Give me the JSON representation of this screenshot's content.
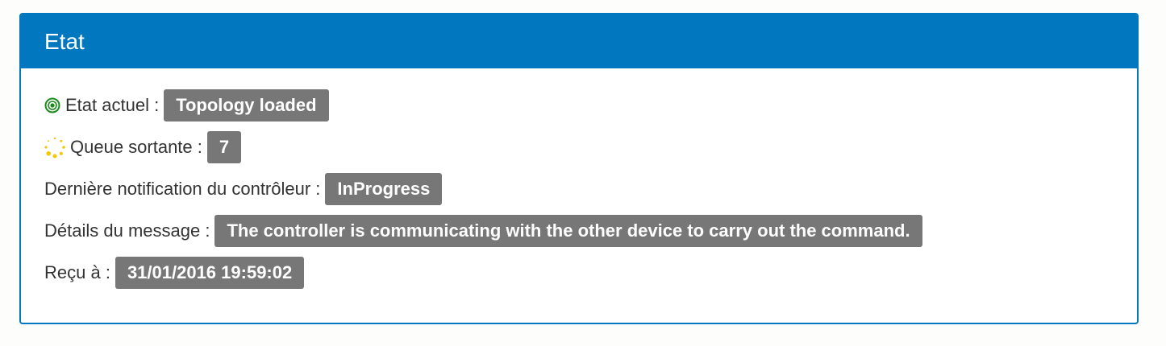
{
  "panel": {
    "title": "Etat"
  },
  "rows": [
    {
      "label": "Etat actuel :",
      "value": "Topology loaded",
      "icon": "status-ok-icon"
    },
    {
      "label": "Queue sortante :",
      "value": "7",
      "icon": "spinner-icon"
    },
    {
      "label": "Dernière notification du contrôleur :",
      "value": "InProgress"
    },
    {
      "label": "Détails du message :",
      "value": "The controller is communicating with the other device to carry out the command."
    },
    {
      "label": "Reçu à :",
      "value": "31/01/2016 19:59:02"
    }
  ],
  "colors": {
    "accent": "#0077be",
    "badge": "#777777",
    "status_ok": "#1a8a1a",
    "spinner": "#f2c800"
  }
}
